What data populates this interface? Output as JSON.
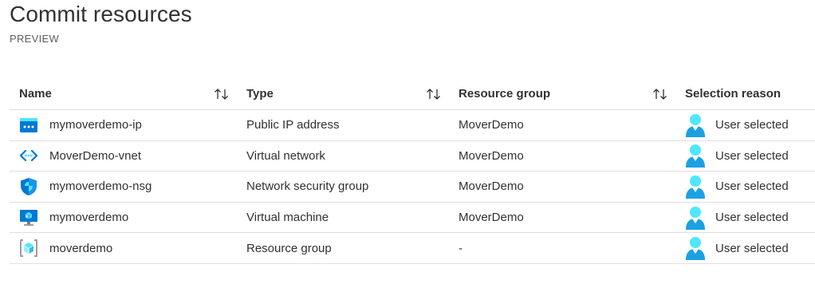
{
  "page": {
    "title": "Commit resources",
    "subtitle": "PREVIEW"
  },
  "columns": {
    "name": "Name",
    "type": "Type",
    "resource_group": "Resource group",
    "selection_reason": "Selection reason"
  },
  "rows": [
    {
      "icon": "public-ip-icon",
      "name": "mymoverdemo-ip",
      "type": "Public IP address",
      "resource_group": "MoverDemo",
      "reason": "User selected"
    },
    {
      "icon": "virtual-network-icon",
      "name": "MoverDemo-vnet",
      "type": "Virtual network",
      "resource_group": "MoverDemo",
      "reason": "User selected"
    },
    {
      "icon": "network-security-group-icon",
      "name": "mymoverdemo-nsg",
      "type": "Network security group",
      "resource_group": "MoverDemo",
      "reason": "User selected"
    },
    {
      "icon": "virtual-machine-icon",
      "name": "mymoverdemo",
      "type": "Virtual machine",
      "resource_group": "MoverDemo",
      "reason": "User selected"
    },
    {
      "icon": "resource-group-icon",
      "name": "moverdemo",
      "type": "Resource group",
      "resource_group": "-",
      "reason": "User selected"
    }
  ],
  "colors": {
    "azure_blue": "#0078d4",
    "light_blue": "#50e6ff",
    "divider": "#e1dfdd",
    "text": "#323130"
  }
}
